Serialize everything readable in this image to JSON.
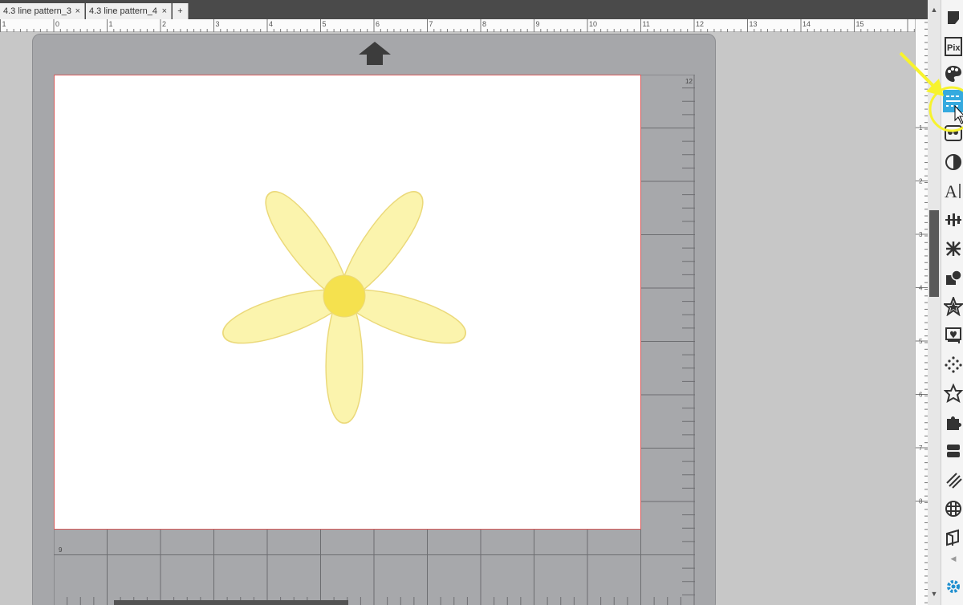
{
  "tabs": [
    {
      "label": "4.3 line pattern_3",
      "close": "×"
    },
    {
      "label": "4.3 line pattern_4",
      "close": "×"
    }
  ],
  "add_tab_label": "+",
  "ruler": {
    "h_labels": [
      "1",
      "0",
      "1",
      "2",
      "3",
      "4",
      "5",
      "6",
      "7",
      "8",
      "9",
      "10",
      "11",
      "12",
      "13",
      "14",
      "15"
    ],
    "v_labels": [
      "1",
      "2",
      "3",
      "4",
      "5",
      "6",
      "7",
      "8"
    ]
  },
  "mat": {
    "corner_top_label": "12",
    "corner_bottom_label": "9"
  },
  "toolbar": {
    "pix_label": "Pix",
    "text_tool_label": "A"
  },
  "colors": {
    "petal_fill": "#fbf4ad",
    "petal_stroke": "#ebd97a",
    "center_fill": "#f5e14e",
    "active_tool": "#35aadf",
    "annotation": "#f7f32d",
    "page_border": "#d65a5a"
  }
}
